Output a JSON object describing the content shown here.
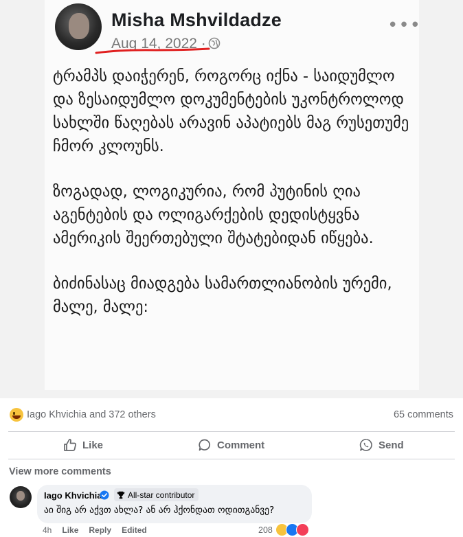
{
  "post": {
    "author": "Misha Mshvildadze",
    "date": "Aug 14, 2022",
    "date_sep": "·",
    "more": "•••",
    "paragraphs": [
      "ტრამპს დაიჭერენ, როგორც იქნა - საიდუმლო და ზესაიდუმლო დოკუმენტების უკონტროლოდ სახლში წაღებას არავინ აპატიებს მაგ რუსეთუმე ჩმორ კლოუნს.",
      "ზოგადად, ლოგიკურია, რომ პუტინის ღია აგენტების და ოლიგარქების დედისტყვნა ამერიკის შეერთებული შტატებიდან იწყება.",
      "ბიძინასაც მიადგება სამართლიანობის ურემი, მალე, მალე:"
    ]
  },
  "reactions": {
    "names": "Iago Khvichia and 372 others",
    "comments": "65 comments"
  },
  "actions": {
    "like": "Like",
    "comment": "Comment",
    "send": "Send"
  },
  "view_more": "View more comments",
  "comment": {
    "name": "Iago Khvichia",
    "badge": "All-star contributor",
    "text": "აი შიგ არ აქვთ ახლა? ან არ ჰქონდათ ოდითგანვე?",
    "time": "4h",
    "like": "Like",
    "reply": "Reply",
    "edited": "Edited",
    "reaction_count": "208"
  },
  "colors": {
    "accent": "#1877f2",
    "date_underline": "#e02020",
    "meta_gray": "#65676b"
  }
}
